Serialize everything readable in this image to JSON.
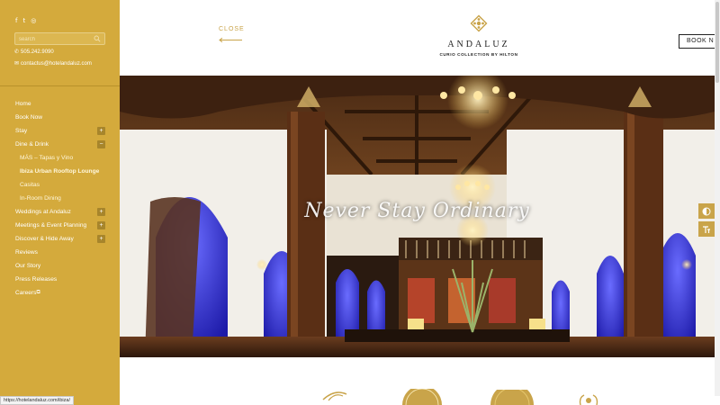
{
  "sidebar": {
    "social": [
      {
        "icon": "facebook-icon",
        "glyph": "f"
      },
      {
        "icon": "twitter-icon",
        "glyph": "t"
      },
      {
        "icon": "instagram-icon",
        "glyph": "◎"
      }
    ],
    "search": {
      "placeholder": "search"
    },
    "phone": "505.242.9090",
    "email": "contactus@hotelandaluz.com",
    "nav": [
      {
        "label": "Home",
        "sub": false,
        "toggle": ""
      },
      {
        "label": "Book Now",
        "sub": false,
        "toggle": ""
      },
      {
        "label": "Stay",
        "sub": false,
        "toggle": "+"
      },
      {
        "label": "Dine & Drink",
        "sub": false,
        "toggle": "−"
      },
      {
        "label": "MÁS – Tapas y Vino",
        "sub": true,
        "toggle": ""
      },
      {
        "label": "Ibiza Urban Rooftop Lounge",
        "sub": true,
        "toggle": "",
        "active": true
      },
      {
        "label": "Casitas",
        "sub": true,
        "toggle": ""
      },
      {
        "label": "In-Room Dining",
        "sub": true,
        "toggle": ""
      },
      {
        "label": "Weddings at Andaluz",
        "sub": false,
        "toggle": "+"
      },
      {
        "label": "Meetings & Event Planning",
        "sub": false,
        "toggle": "+"
      },
      {
        "label": "Discover & Hide Away",
        "sub": false,
        "toggle": "+"
      },
      {
        "label": "Reviews",
        "sub": false,
        "toggle": ""
      },
      {
        "label": "Our Story",
        "sub": false,
        "toggle": ""
      },
      {
        "label": "Press Releases",
        "sub": false,
        "toggle": ""
      },
      {
        "label": "Careers",
        "sub": false,
        "toggle": "",
        "external": true
      }
    ],
    "status_url": "https://hotelandaluz.com/ibiza/"
  },
  "header": {
    "close_label": "CLOSE",
    "logo_name": "ANDALUZ",
    "logo_tag": "CURIO COLLECTION BY HILTON",
    "book_label": "BOOK N"
  },
  "hero": {
    "tagline": "Never Stay Ordinary"
  },
  "colors": {
    "sidebar": "#d4aa3c",
    "accent": "#c9a44a"
  }
}
